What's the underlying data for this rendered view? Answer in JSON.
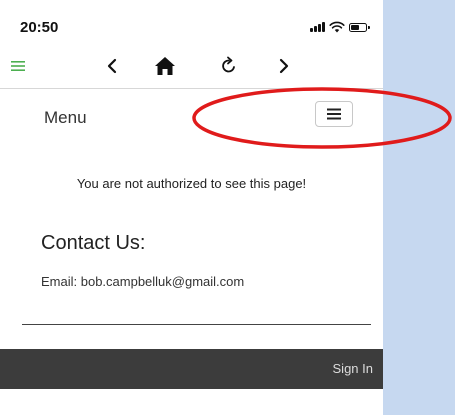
{
  "status_bar": {
    "time": "20:50",
    "icons": [
      "signal-icon",
      "wifi-icon",
      "battery-icon"
    ]
  },
  "toolbar": {
    "icons": [
      "hamburger-icon",
      "back-icon",
      "home-icon",
      "reload-icon",
      "forward-icon"
    ],
    "colors": {
      "hamburger": "#4caf50",
      "icons": "#111111"
    }
  },
  "nav": {
    "menu_label": "Menu",
    "toggle_icon": "hamburger-icon"
  },
  "annotation": {
    "color": "#e01b1b"
  },
  "content": {
    "message": "You are not authorized to see this page!",
    "contact_heading": "Contact Us:",
    "email_line": "Email: bob.campbelluk@gmail.com"
  },
  "footer": {
    "sign_in_label": "Sign In",
    "background": "#3c3c3c"
  }
}
